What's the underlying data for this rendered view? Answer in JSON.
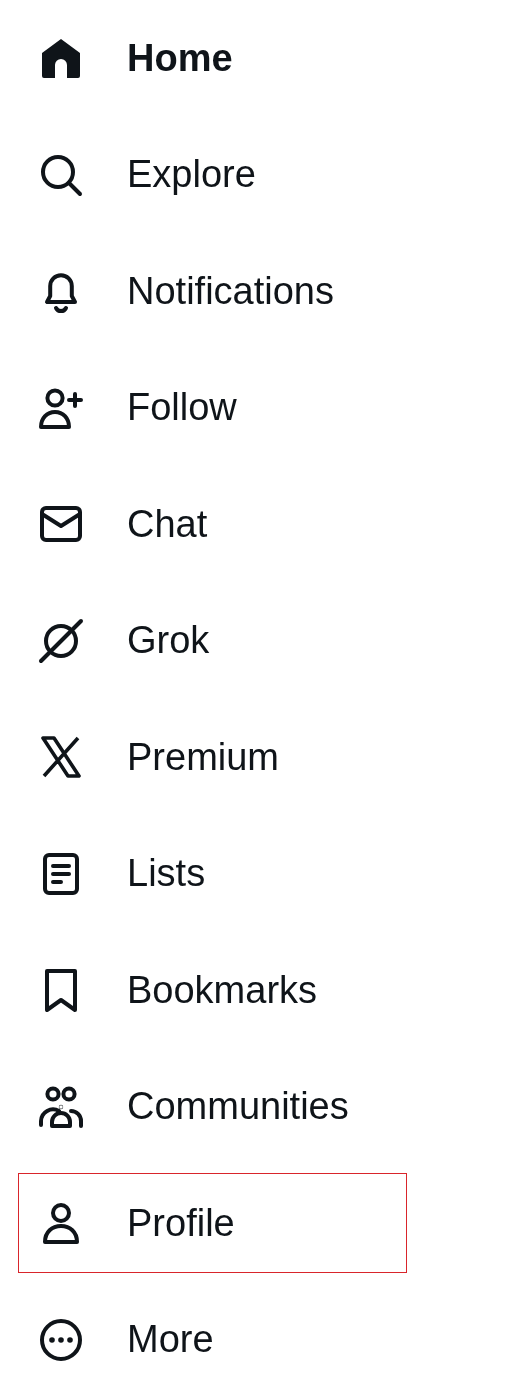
{
  "nav": {
    "items": [
      {
        "kind": "home",
        "label": "Home",
        "selected": true,
        "highlighted": false
      },
      {
        "kind": "explore",
        "label": "Explore",
        "selected": false,
        "highlighted": false
      },
      {
        "kind": "notifications",
        "label": "Notifications",
        "selected": false,
        "highlighted": false
      },
      {
        "kind": "follow",
        "label": "Follow",
        "selected": false,
        "highlighted": false
      },
      {
        "kind": "chat",
        "label": "Chat",
        "selected": false,
        "highlighted": false
      },
      {
        "kind": "grok",
        "label": "Grok",
        "selected": false,
        "highlighted": false
      },
      {
        "kind": "premium",
        "label": "Premium",
        "selected": false,
        "highlighted": false
      },
      {
        "kind": "lists",
        "label": "Lists",
        "selected": false,
        "highlighted": false
      },
      {
        "kind": "bookmarks",
        "label": "Bookmarks",
        "selected": false,
        "highlighted": false
      },
      {
        "kind": "communities",
        "label": "Communities",
        "selected": false,
        "highlighted": false
      },
      {
        "kind": "profile",
        "label": "Profile",
        "selected": false,
        "highlighted": true
      },
      {
        "kind": "more",
        "label": "More",
        "selected": false,
        "highlighted": false
      }
    ]
  }
}
